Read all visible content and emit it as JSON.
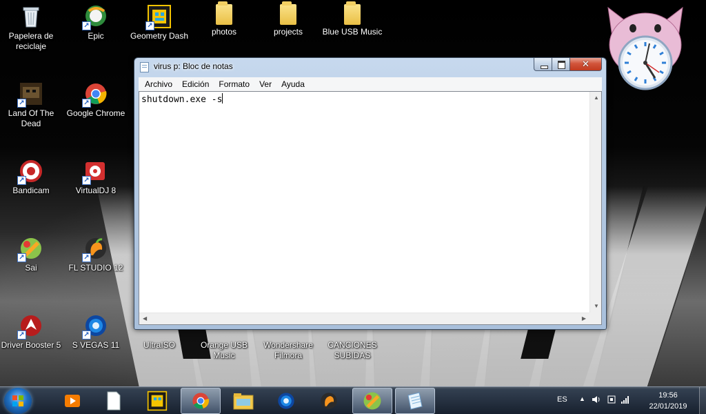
{
  "desktop": {
    "icons": [
      {
        "label": "Papelera de reciclaje"
      },
      {
        "label": "Epic"
      },
      {
        "label": "Geometry Dash"
      },
      {
        "label": "photos"
      },
      {
        "label": "projects"
      },
      {
        "label": "Blue USB Music"
      },
      {
        "label": "Land Of The Dead"
      },
      {
        "label": "Google Chrome"
      },
      {
        "label": "Bandicam"
      },
      {
        "label": "VirtualDJ 8"
      },
      {
        "label": "Sai"
      },
      {
        "label": "FL STUDIO 12"
      },
      {
        "label": "Driver Booster 5"
      },
      {
        "label": "S VEGAS 11"
      },
      {
        "label": "UltraISO"
      },
      {
        "label": "Orange USB Music"
      },
      {
        "label": "Wondershare Filmora"
      },
      {
        "label": "CANCIONES SUBIDAS"
      }
    ]
  },
  "window": {
    "title": "virus p: Bloc de notas",
    "close_glyph": "✕",
    "menu": [
      "Archivo",
      "Edición",
      "Formato",
      "Ver",
      "Ayuda"
    ],
    "content": "shutdown.exe -s"
  },
  "taskbar": {
    "apps": [
      {
        "icon": "media-player-icon"
      },
      {
        "icon": "blank-document-icon"
      },
      {
        "icon": "geometry-dash-icon"
      },
      {
        "icon": "google-chrome-icon"
      },
      {
        "icon": "file-explorer-icon"
      },
      {
        "icon": "vegas-icon"
      },
      {
        "icon": "fl-studio-icon"
      },
      {
        "icon": "sai-icon"
      },
      {
        "icon": "notepad-icon"
      }
    ],
    "language": "ES",
    "time": "19:56",
    "date": "22/01/2019"
  },
  "colors": {
    "window_frame": "#b6cbe4",
    "close_button": "#c13a1f",
    "taskbar": "#1c2636"
  }
}
